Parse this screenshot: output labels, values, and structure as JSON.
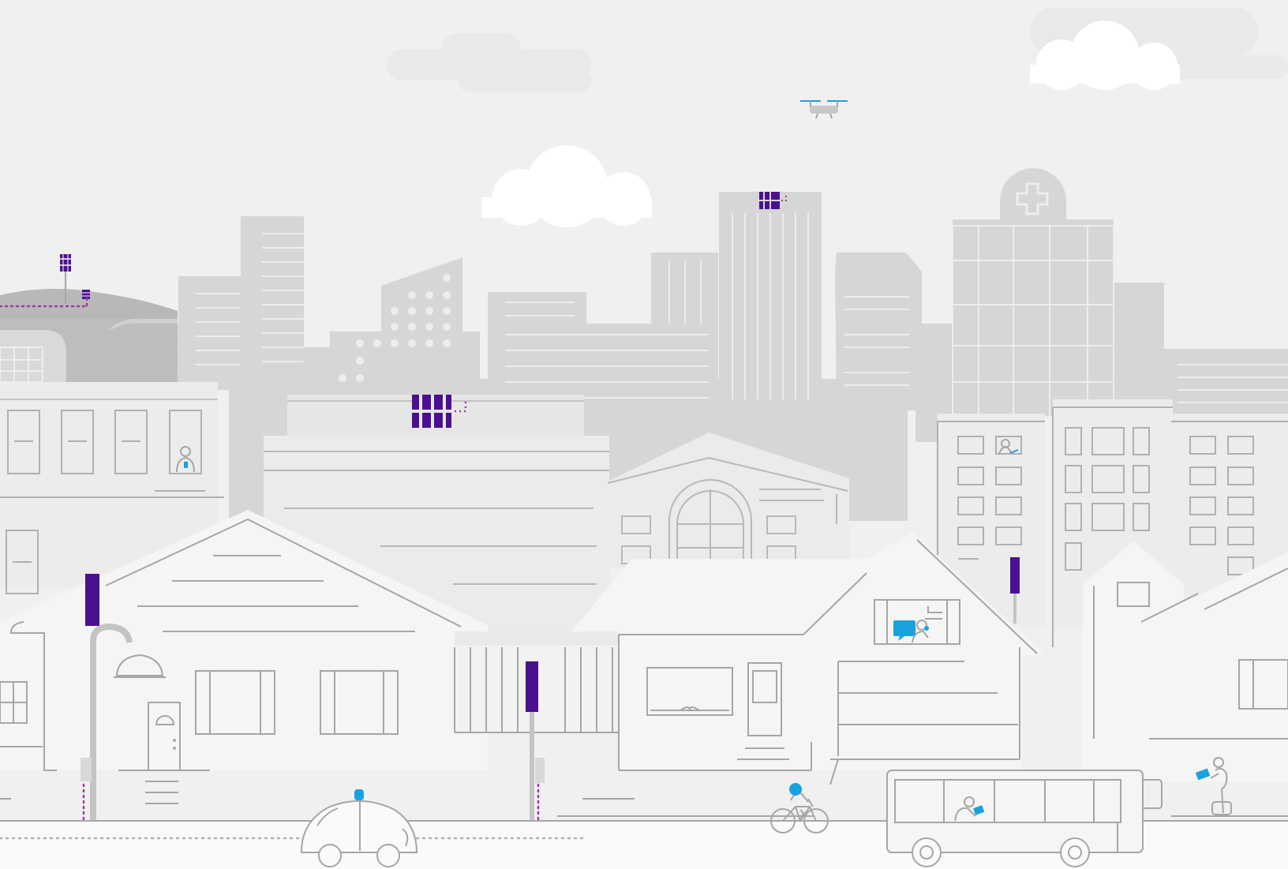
{
  "scene": {
    "colors": {
      "sky": "#f0f0f0",
      "cloud": "#ffffff",
      "cloud_faint": "#e8e8e8",
      "building_far": "#d6d6d6",
      "building_mid": "#e2e2e2",
      "building_near": "#ebebeb",
      "house_fill": "#f5f5f4",
      "line": "#a6a6a6",
      "line_light": "#c4c4c4",
      "hill": "#b5b5b5",
      "ground": "#fafafa",
      "accent_purple": "#4b1090",
      "dot_purple": "#9b3aa5",
      "accent_blue": "#1aa1e0"
    },
    "icons": [
      "cloud-icon",
      "drone-icon",
      "cell-tower-antenna-icon",
      "small-cell-icon",
      "hospital-cross-icon",
      "person-with-phone-icon",
      "person-with-laptop-icon",
      "person-with-chat-icon",
      "autonomous-car-icon",
      "cyclist-icon",
      "bus-icon",
      "bus-passenger-icon",
      "person-on-scooter-icon",
      "street-lamp-icon"
    ]
  }
}
